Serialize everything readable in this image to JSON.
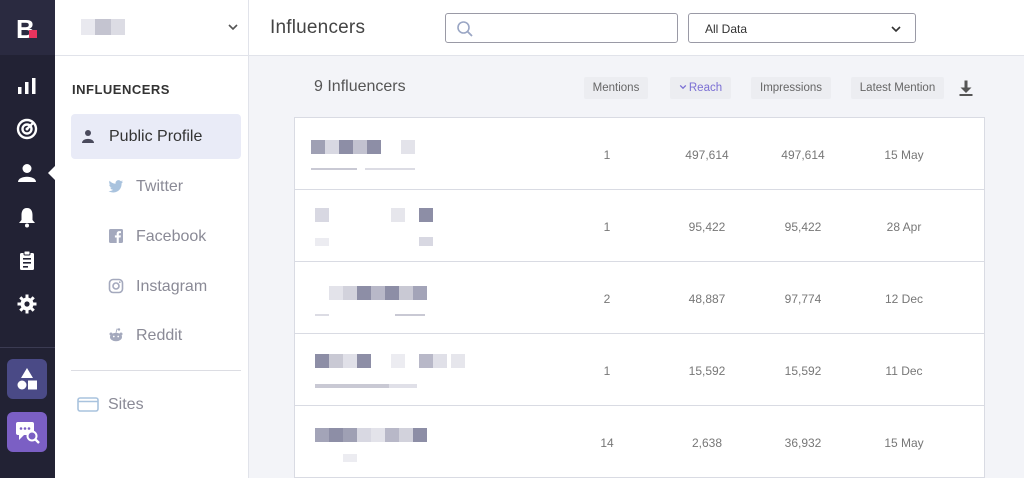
{
  "app": {
    "logo_letter": "B",
    "page_title": "Influencers",
    "accent_color": "#7b6fd4",
    "rail_color": "#222234"
  },
  "rail": {
    "icons": [
      "bar-chart-icon",
      "radar-icon",
      "person-icon",
      "bell-icon",
      "clipboard-icon",
      "gear-icon"
    ],
    "apps": [
      "shapes-app-icon",
      "search-chat-app-icon"
    ]
  },
  "search": {
    "value": "",
    "placeholder": ""
  },
  "filter": {
    "selected": "All Data",
    "icon": "chevron-down-icon"
  },
  "sidenav": {
    "heading": "INFLUENCERS",
    "items": [
      {
        "label": "Public Profile",
        "icon": "person-icon",
        "active": true
      },
      {
        "label": "Twitter",
        "icon": "twitter-icon",
        "active": false
      },
      {
        "label": "Facebook",
        "icon": "facebook-icon",
        "active": false
      },
      {
        "label": "Instagram",
        "icon": "instagram-icon",
        "active": false
      },
      {
        "label": "Reddit",
        "icon": "reddit-icon",
        "active": false
      }
    ],
    "sites_label": "Sites"
  },
  "main": {
    "count_label": "9 Influencers",
    "columns": {
      "mentions": "Mentions",
      "reach": "Reach",
      "impressions": "Impressions",
      "latest_mention": "Latest Mention"
    },
    "sorted_column": "reach",
    "rows": [
      {
        "mentions": "1",
        "reach": "497,614",
        "impressions": "497,614",
        "latest": "15 May"
      },
      {
        "mentions": "1",
        "reach": "95,422",
        "impressions": "95,422",
        "latest": "28 Apr"
      },
      {
        "mentions": "2",
        "reach": "48,887",
        "impressions": "97,774",
        "latest": "12 Dec"
      },
      {
        "mentions": "1",
        "reach": "15,592",
        "impressions": "15,592",
        "latest": "11 Dec"
      },
      {
        "mentions": "14",
        "reach": "2,638",
        "impressions": "36,932",
        "latest": "15 May"
      }
    ]
  }
}
